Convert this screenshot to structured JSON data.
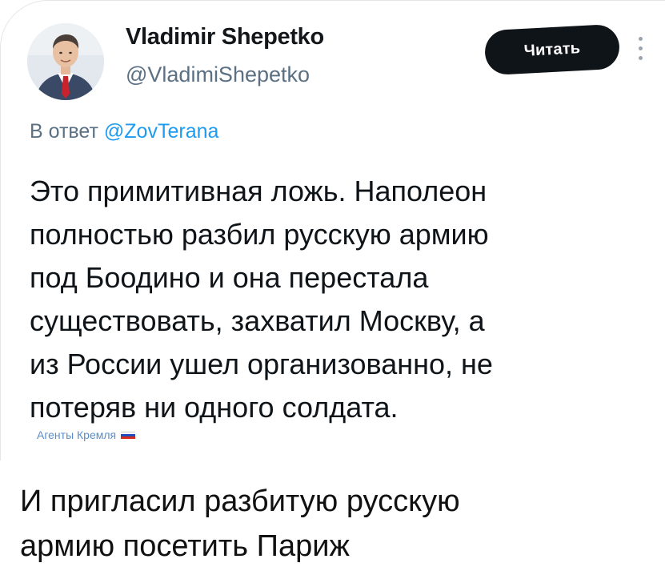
{
  "tweet": {
    "author": {
      "display_name": "Vladimir Shepetko",
      "handle": "@VladimiShepetko",
      "avatar_icon": "profile-photo-man-in-suit"
    },
    "follow_button_label": "Читать",
    "more_icon": "vertical-ellipsis-icon",
    "reply_prefix": "В ответ",
    "reply_mention": "@ZovTerana",
    "text_lines": [
      "Это примитивная ложь. Наполеон",
      "полностью разбил русскую армию",
      "под Боодино и она перестала",
      "существовать, захватил Москву, а",
      "из России ушел организованно, не",
      "потеряв ни одного солдата."
    ]
  },
  "watermark": {
    "text": "Агенты Кремля",
    "flag_icon": "russian-flag-icon",
    "flag_colors": [
      "#ffffff",
      "#1f4fbf",
      "#d52b1e"
    ]
  },
  "caption": {
    "lines": [
      "И пригласил разбитую русскую",
      "армию посетить Париж"
    ]
  },
  "colors": {
    "button_bg": "#0f1419",
    "mention": "#1d9bf0",
    "secondary_text": "#5b7083"
  }
}
